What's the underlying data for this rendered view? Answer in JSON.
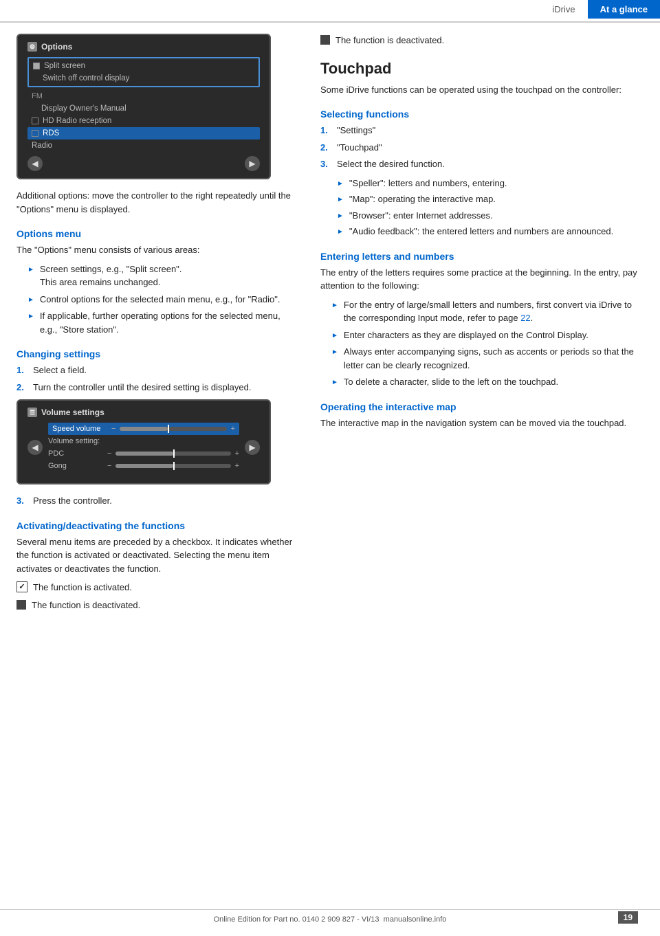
{
  "header": {
    "tab_idrive": "iDrive",
    "tab_at_glance": "At a glance"
  },
  "left_col": {
    "screen1": {
      "title": "Options",
      "icon_label": "gear",
      "items": [
        {
          "text": "Split screen",
          "type": "checked",
          "indent": false
        },
        {
          "text": "Switch off control display",
          "type": "normal",
          "indent": true
        },
        {
          "text": "FM",
          "type": "section",
          "indent": false
        },
        {
          "text": "Display Owner's Manual",
          "type": "normal",
          "indent": true
        },
        {
          "text": "HD Radio reception",
          "type": "checkbox",
          "indent": false,
          "checked": false
        },
        {
          "text": "RDS",
          "type": "checkbox_selected",
          "indent": false,
          "checked": false
        },
        {
          "text": "Radio",
          "type": "normal",
          "indent": false
        }
      ]
    },
    "caption1": "Additional options: move the controller to the right repeatedly until the \"Options\" menu is displayed.",
    "options_menu_heading": "Options menu",
    "options_menu_intro": "The \"Options\" menu consists of various areas:",
    "options_bullets": [
      {
        "text": "Screen settings, e.g., \"Split screen\".",
        "sub": "This area remains unchanged."
      },
      {
        "text": "Control options for the selected main menu, e.g., for \"Radio\".",
        "sub": null
      },
      {
        "text": "If applicable, further operating options for the selected menu, e.g., \"Store station\".",
        "sub": null
      }
    ],
    "changing_settings_heading": "Changing settings",
    "changing_steps": [
      "Select a field.",
      "Turn the controller until the desired setting is displayed."
    ],
    "screen2": {
      "title": "Volume settings",
      "icon_label": "list",
      "rows": [
        {
          "label": "Speed volume",
          "selected": true,
          "has_slider": true,
          "fill_pct": 45,
          "marker_pct": 45
        },
        {
          "label": "Volume setting:",
          "selected": false,
          "has_slider": false
        },
        {
          "label": "PDC",
          "selected": false,
          "has_slider": true,
          "fill_pct": 50,
          "marker_pct": 50
        },
        {
          "label": "Gong",
          "selected": false,
          "has_slider": true,
          "fill_pct": 50,
          "marker_pct": 50
        }
      ]
    },
    "step3_label": "3.",
    "step3_text": "Press the controller.",
    "activating_heading": "Activating/deactivating the functions",
    "activating_para": "Several menu items are preceded by a checkbox. It indicates whether the function is activated or deactivated. Selecting the menu item activates or deactivates the function.",
    "activated_text": "The function is activated.",
    "deactivated_text": "The function is deactivated."
  },
  "right_col": {
    "touchpad_heading": "Touchpad",
    "touchpad_intro": "Some iDrive functions can be operated using the touchpad on the controller:",
    "selecting_functions_heading": "Selecting functions",
    "selecting_steps": [
      "\"Settings\"",
      "\"Touchpad\"",
      "Select the desired function."
    ],
    "selecting_bullets": [
      "\"Speller\": letters and numbers, entering.",
      "\"Map\": operating the interactive map.",
      "\"Browser\": enter Internet addresses.",
      "\"Audio feedback\": the entered letters and numbers are announced."
    ],
    "entering_heading": "Entering letters and numbers",
    "entering_para": "The entry of the letters requires some practice at the beginning. In the entry, pay attention to the following:",
    "entering_bullets": [
      "For the entry of large/small letters and numbers, first convert via iDrive to the corresponding Input mode, refer to page 22.",
      "Enter characters as they are displayed on the Control Display.",
      "Always enter accompanying signs, such as accents or periods so that the letter can be clearly recognized.",
      "To delete a character, slide to the left on the touchpad."
    ],
    "operating_map_heading": "Operating the interactive map",
    "operating_map_para": "The interactive map in the navigation system can be moved via the touchpad.",
    "page_ref": "22"
  },
  "footer": {
    "text": "Online Edition for Part no. 0140 2 909 827 - VI/13",
    "page_number": "19",
    "site": "manualsonline.info"
  }
}
